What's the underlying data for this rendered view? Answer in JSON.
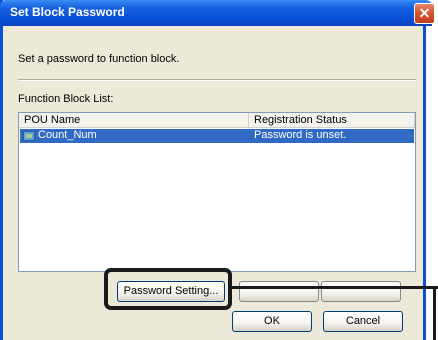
{
  "dialog": {
    "title": "Set Block Password",
    "close_glyph": "✕",
    "description": "Set a password to function block.",
    "list_label": "Function Block List:",
    "columns": [
      "POU Name",
      "Registration Status"
    ],
    "rows": [
      {
        "name": "Count_Num",
        "status": "Password is unset.",
        "icon": "function-block-icon"
      }
    ],
    "buttons": {
      "password_setting": "Password Setting...",
      "ok": "OK",
      "cancel": "Cancel"
    }
  },
  "colors": {
    "title_bar": "#0a4fd8",
    "selection": "#316ac5",
    "dialog_bg": "#ece9d8"
  }
}
